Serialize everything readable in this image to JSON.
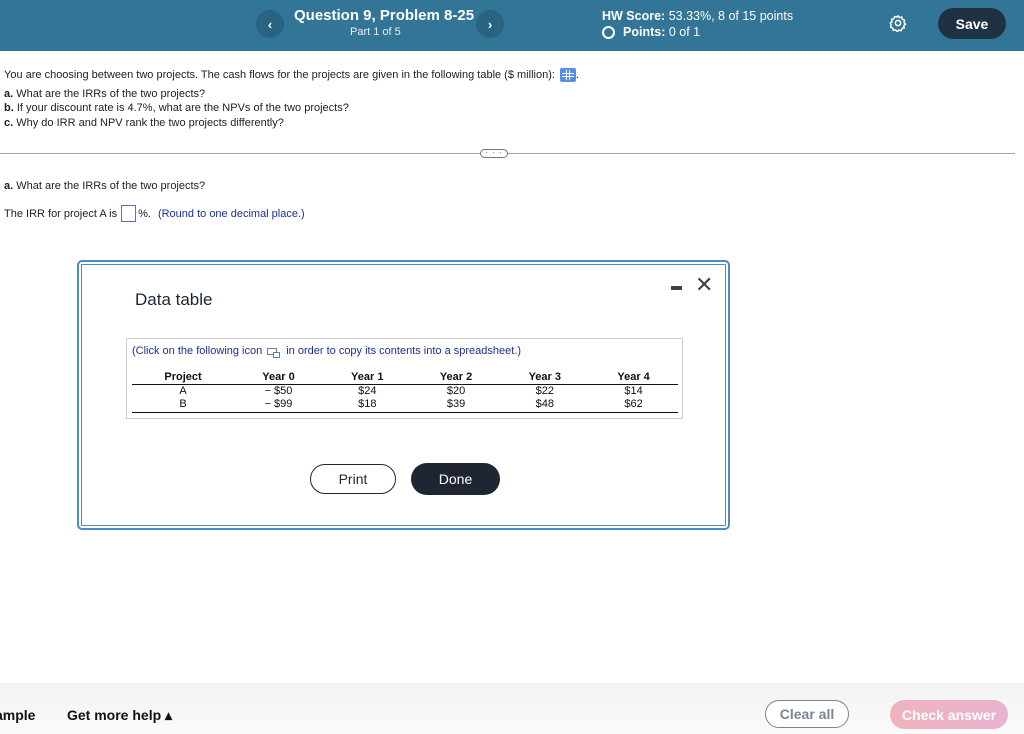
{
  "header": {
    "prev_label": "‹",
    "next_label": "›",
    "question_title": "Question 9, Problem 8-25",
    "part": "Part 1 of 5",
    "hw_score_label": "HW Score:",
    "hw_score_value": "53.33%, 8 of 15 points",
    "points_label": "Points:",
    "points_value": "0 of 1",
    "save_label": "Save",
    "icons": {
      "settings": "gear-icon",
      "points_status": "circle-icon"
    }
  },
  "problem": {
    "intro": "You are choosing between two projects. The cash flows for the projects are given in the following table ($ million):",
    "intro_end": ".",
    "parts": [
      {
        "letter": "a.",
        "text": "What are the IRRs of the two projects?"
      },
      {
        "letter": "b.",
        "text": "If your discount rate is 4.7%, what are the NPVs of the two projects?"
      },
      {
        "letter": "c.",
        "text": "Why do IRR and NPV rank the two projects differently?"
      }
    ],
    "more_label": "· · ·"
  },
  "question": {
    "letter": "a.",
    "text": "What are the IRRs of the two projects?",
    "irr_prefix": "The IRR for project A is",
    "irr_value": "",
    "irr_suffix": "%.",
    "hint": "(Round to one decimal place.)"
  },
  "modal": {
    "title": "Data table",
    "copy_note_before": "(Click on the following icon",
    "copy_note_after": "in order to copy its contents into a spreadsheet.)",
    "columns": [
      "Project",
      "Year 0",
      "Year 1",
      "Year 2",
      "Year 3",
      "Year 4"
    ],
    "rows": [
      [
        "A",
        "− $50",
        "$24",
        "$20",
        "$22",
        "$14"
      ],
      [
        "B",
        "− $99",
        "$18",
        "$39",
        "$48",
        "$62"
      ]
    ],
    "print_label": "Print",
    "done_label": "Done",
    "close_label": "✕"
  },
  "footer": {
    "example_label": "ample",
    "help_label": "Get more help ▴",
    "clear_label": "Clear all",
    "check_label": "Check answer"
  }
}
